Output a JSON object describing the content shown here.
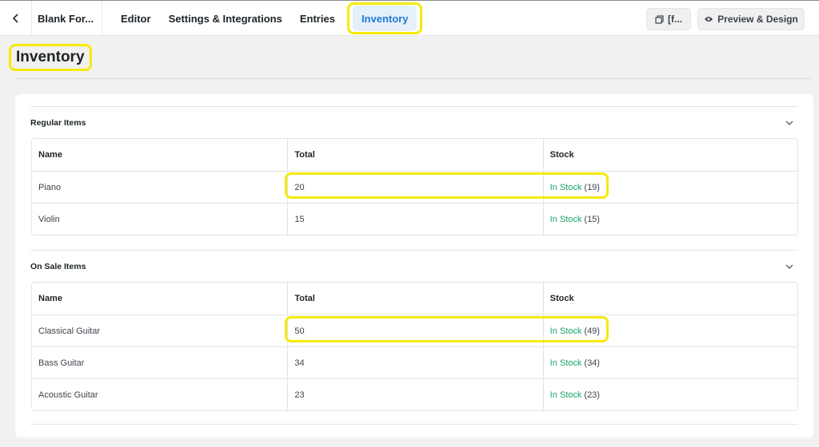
{
  "topbar": {
    "form_title": "Blank For...",
    "tabs": [
      {
        "label": "Editor"
      },
      {
        "label": "Settings & Integrations"
      },
      {
        "label": "Entries"
      },
      {
        "label": "Inventory",
        "active": true
      }
    ],
    "shortcode_button": "[f...",
    "preview_button": "Preview & Design"
  },
  "page": {
    "title": "Inventory"
  },
  "sections": [
    {
      "title": "Regular Items",
      "headers": [
        "Name",
        "Total",
        "Stock"
      ],
      "rows": [
        {
          "name": "Piano",
          "total": "20",
          "stock_label": "In Stock",
          "stock_count": "(19)"
        },
        {
          "name": "Violin",
          "total": "15",
          "stock_label": "In Stock",
          "stock_count": "(15)"
        }
      ]
    },
    {
      "title": "On Sale Items",
      "headers": [
        "Name",
        "Total",
        "Stock"
      ],
      "rows": [
        {
          "name": "Classical Guitar",
          "total": "50",
          "stock_label": "In Stock",
          "stock_count": "(49)"
        },
        {
          "name": "Bass Guitar",
          "total": "34",
          "stock_label": "In Stock",
          "stock_count": "(34)"
        },
        {
          "name": "Acoustic Guitar",
          "total": "23",
          "stock_label": "In Stock",
          "stock_count": "(23)"
        }
      ]
    }
  ],
  "colors": {
    "accent": "#1e7ad4",
    "in_stock": "#17a56b",
    "highlight": "#f5ea0a"
  }
}
